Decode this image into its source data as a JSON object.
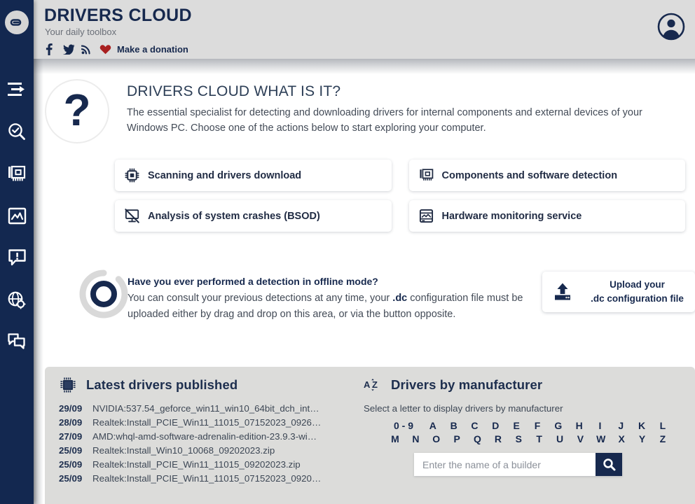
{
  "sidebar": {
    "logo_name": "driverscloud-logo",
    "items": [
      {
        "name": "sidebar-item-menu-arrow",
        "icon": "menu-arrow-icon"
      },
      {
        "name": "sidebar-item-detection",
        "icon": "search-check-icon"
      },
      {
        "name": "sidebar-item-components",
        "icon": "expansion-card-icon"
      },
      {
        "name": "sidebar-item-monitoring",
        "icon": "image-chart-icon"
      },
      {
        "name": "sidebar-item-bsod",
        "icon": "alert-comment-icon"
      },
      {
        "name": "sidebar-item-drivers",
        "icon": "globe-gear-icon"
      },
      {
        "name": "sidebar-item-forum",
        "icon": "chat-bubbles-icon"
      }
    ]
  },
  "header": {
    "title": "DRIVERS CLOUD",
    "subtitle": "Your daily toolbox",
    "social": [
      {
        "name": "facebook-icon",
        "label": "f"
      },
      {
        "name": "twitter-icon",
        "label": ""
      },
      {
        "name": "rss-icon",
        "label": ""
      }
    ],
    "donation_label": "Make a donation",
    "heart_color": "#a92020",
    "avatar_name": "user-avatar",
    "brand_color": "#17294e",
    "bar_color": "#dcdcdc"
  },
  "intro": {
    "icon": "question-mark-icon",
    "question_glyph": "?",
    "title": "DRIVERS CLOUD WHAT IS IT?",
    "body": "The essential specialist for detecting and downloading drivers for internal components and external devices of your Windows PC. Choose one of the actions below to start exploring your computer."
  },
  "actions": [
    {
      "label": "Scanning and drivers download",
      "icon": "cpu-chip-icon",
      "name": "action-scanning-drivers-download"
    },
    {
      "label": "Components and software detection",
      "icon": "expansion-card-icon",
      "name": "action-components-software-detection"
    },
    {
      "label": "Analysis of system crashes (BSOD)",
      "icon": "monitor-crash-icon",
      "name": "action-analysis-system-crashes"
    },
    {
      "label": "Hardware monitoring service",
      "icon": "monitor-graph-icon",
      "name": "action-hardware-monitoring-service"
    }
  ],
  "offline": {
    "icon": "loading-ring-icon",
    "title": "Have you ever performed a detection in offline mode?",
    "body_before": "You can consult your previous detections at any time, your ",
    "body_strong": ".dc",
    "body_after": " configuration file must be uploaded either by drag and drop on this area, or via the button opposite.",
    "upload_icon": "upload-icon",
    "upload_line1": "Upload your",
    "upload_line2": ".dc configuration file"
  },
  "latest_drivers": {
    "icon": "cpu-chip-icon",
    "title": "Latest drivers published",
    "rows": [
      {
        "date": "29/09",
        "name": "NVIDIA:537.54_geforce_win11_win10_64bit_dch_int…"
      },
      {
        "date": "28/09",
        "name": "Realtek:Install_PCIE_Win11_11015_07152023_0926…"
      },
      {
        "date": "27/09",
        "name": "AMD:whql-amd-software-adrenalin-edition-23.9.3-wi…"
      },
      {
        "date": "25/09",
        "name": "Realtek:Install_Win10_10068_09202023.zip"
      },
      {
        "date": "25/09",
        "name": "Realtek:Install_PCIE_Win11_11015_09202023.zip"
      },
      {
        "date": "25/09",
        "name": "Realtek:Install_PCIE_Win11_11015_07152023_0920…"
      }
    ]
  },
  "manufacturers": {
    "icon": "sort-az-icon",
    "title": "Drivers by manufacturer",
    "hint": "Select a letter to display drivers by manufacturer",
    "alphabet_row1": [
      "0 - 9",
      "A",
      "B",
      "C",
      "D",
      "E",
      "F",
      "G",
      "H",
      "I",
      "J",
      "K",
      "L"
    ],
    "alphabet_row2": [
      "M",
      "N",
      "O",
      "P",
      "Q",
      "R",
      "S",
      "T",
      "U",
      "V",
      "W",
      "X",
      "Y",
      "Z"
    ],
    "search_placeholder": "Enter the name of a builder",
    "search_value": "",
    "search_icon": "magnifier-icon",
    "search_button_color": "#17294e"
  },
  "theme": {
    "sidebar_bg": "#132850",
    "panel_bg": "#dcdcda",
    "page_bg": "#ffffff",
    "text_dark": "#17294e",
    "text_body": "#434b57"
  }
}
